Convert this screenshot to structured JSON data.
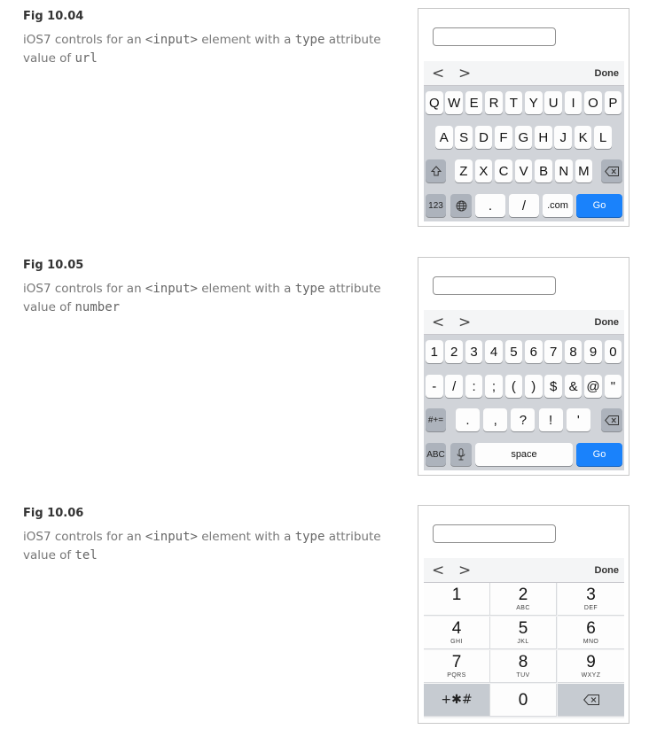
{
  "figures": [
    {
      "title": "Fig 10.04",
      "caption_pre": "iOS7 controls for an ",
      "caption_elem": "<input>",
      "caption_mid": " element with a ",
      "caption_attr": "type",
      "caption_post": " attribute value of ",
      "caption_value": "url",
      "accessory": {
        "prev": "<",
        "next": ">",
        "done": "Done"
      },
      "keyboard": {
        "row1": [
          "Q",
          "W",
          "E",
          "R",
          "T",
          "Y",
          "U",
          "I",
          "O",
          "P"
        ],
        "row2": [
          "A",
          "S",
          "D",
          "F",
          "G",
          "H",
          "J",
          "K",
          "L"
        ],
        "row3": [
          "Z",
          "X",
          "C",
          "V",
          "B",
          "N",
          "M"
        ],
        "shift_icon": "shift-icon",
        "delete_icon": "delete-icon",
        "mode": "123",
        "globe_icon": "globe-icon",
        "dot": ".",
        "slash": "/",
        "dotcom": ".com",
        "go": "Go"
      }
    },
    {
      "title": "Fig 10.05",
      "caption_pre": "iOS7 controls for an ",
      "caption_elem": "<input>",
      "caption_mid": " element with a ",
      "caption_attr": "type",
      "caption_post": " attribute value of ",
      "caption_value": "number",
      "accessory": {
        "prev": "<",
        "next": ">",
        "done": "Done"
      },
      "keyboard": {
        "row1": [
          "1",
          "2",
          "3",
          "4",
          "5",
          "6",
          "7",
          "8",
          "9",
          "0"
        ],
        "row2": [
          "-",
          "/",
          ":",
          ";",
          "(",
          ")",
          "$",
          "&",
          "@",
          "\""
        ],
        "row3_mode": "#+=",
        "row3": [
          ".",
          ",",
          "?",
          "!",
          "'"
        ],
        "delete_icon": "delete-icon",
        "mode": "ABC",
        "mic_icon": "microphone-icon",
        "space": "space",
        "go": "Go"
      }
    },
    {
      "title": "Fig 10.06",
      "caption_pre": "iOS7 controls for an ",
      "caption_elem": "<input>",
      "caption_mid": " element with a ",
      "caption_attr": "type",
      "caption_post": " attribute value of ",
      "caption_value": "tel",
      "accessory": {
        "prev": "<",
        "next": ">",
        "done": "Done"
      },
      "keypad": {
        "keys": [
          {
            "digit": "1",
            "letters": ""
          },
          {
            "digit": "2",
            "letters": "ABC"
          },
          {
            "digit": "3",
            "letters": "DEF"
          },
          {
            "digit": "4",
            "letters": "GHI"
          },
          {
            "digit": "5",
            "letters": "JKL"
          },
          {
            "digit": "6",
            "letters": "MNO"
          },
          {
            "digit": "7",
            "letters": "PQRS"
          },
          {
            "digit": "8",
            "letters": "TUV"
          },
          {
            "digit": "9",
            "letters": "WXYZ"
          }
        ],
        "symbols": "+✱#",
        "zero": "0",
        "delete_icon": "delete-icon"
      }
    }
  ]
}
